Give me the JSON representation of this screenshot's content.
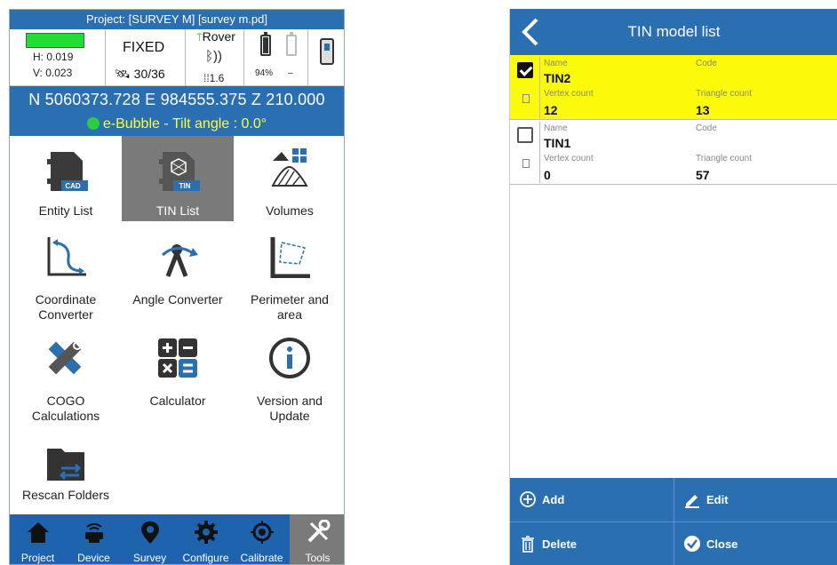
{
  "left": {
    "project_bar": "Project: [SURVEY M] [survey m.pd]",
    "status": {
      "h": "H: 0.019",
      "v": "V: 0.023",
      "fix": "FIXED",
      "satellites": "30/36",
      "mode": "Rover",
      "pdop": "1.6",
      "battery1": "94%",
      "battery2": "–"
    },
    "coordinates": "N 5060373.728   E 984555.375   Z 210.000",
    "bubble": "e-Bubble - Tilt angle : 0.0°",
    "tiles": [
      {
        "label": "Entity List",
        "icon": "cad-file-icon"
      },
      {
        "label": "TIN List",
        "icon": "tin-file-icon",
        "selected": true
      },
      {
        "label": "Volumes",
        "icon": "volumes-icon"
      },
      {
        "label": "Coordinate\nConverter",
        "icon": "coordinate-converter-icon"
      },
      {
        "label": "Angle Converter",
        "icon": "angle-converter-icon"
      },
      {
        "label": "Perimeter and\narea",
        "icon": "perimeter-area-icon"
      },
      {
        "label": "COGO\nCalculations",
        "icon": "cogo-icon"
      },
      {
        "label": "Calculator",
        "icon": "calculator-icon"
      },
      {
        "label": "Version and\nUpdate",
        "icon": "info-icon"
      },
      {
        "label": "Rescan Folders",
        "icon": "rescan-folder-icon"
      }
    ],
    "nav": [
      "Project",
      "Device",
      "Survey",
      "Configure",
      "Calibrate",
      "Tools"
    ]
  },
  "right": {
    "title": "TIN model list",
    "rows": [
      {
        "checked": true,
        "name_label": "Name",
        "name": "TIN2",
        "code_label": "Code",
        "code": "",
        "vertex_label": "Vertex count",
        "vertex": "12",
        "triangle_label": "Triangle count",
        "triangle": "13"
      },
      {
        "checked": false,
        "name_label": "Name",
        "name": "TIN1",
        "code_label": "Code",
        "code": "",
        "vertex_label": "Vertex count",
        "vertex": "0",
        "triangle_label": "Triangle count",
        "triangle": "57"
      }
    ],
    "actions": {
      "add": "Add",
      "edit": "Edit",
      "delete": "Delete",
      "close": "Close"
    }
  },
  "colors": {
    "accent": "#2a6fb2",
    "nav": "#1e63ad",
    "selected_tile": "#7a7a7a",
    "highlight_row": "#fafa0a",
    "bubble_text": "#ffff33",
    "fix_green": "#22dd33"
  }
}
